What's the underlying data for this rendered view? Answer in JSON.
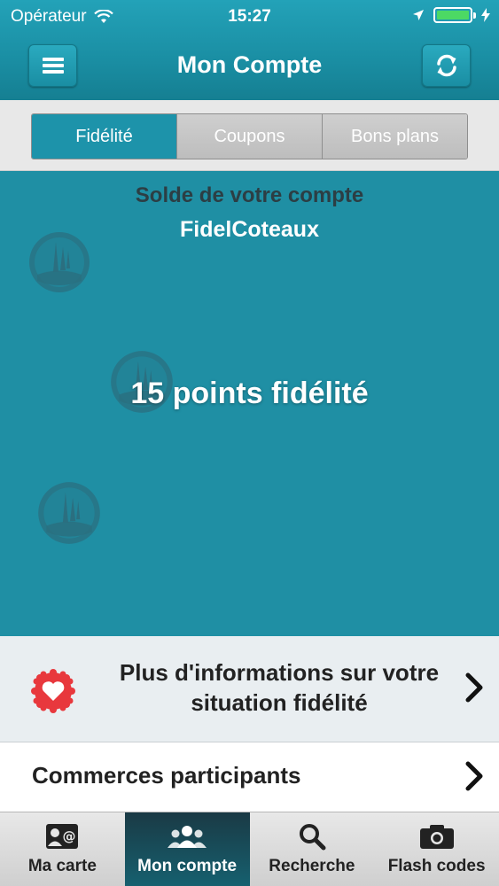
{
  "status": {
    "carrier": "Opérateur",
    "time": "15:27"
  },
  "nav": {
    "title": "Mon Compte",
    "menu_icon": "hamburger-menu-icon",
    "refresh_icon": "refresh-icon"
  },
  "segments": [
    {
      "label": "Fidélité",
      "active": true
    },
    {
      "label": "Coupons",
      "active": false
    },
    {
      "label": "Bons plans",
      "active": false
    }
  ],
  "balance": {
    "title": "Solde de votre compte",
    "account_name": "FidelCoteaux",
    "points": "15 points fidélité"
  },
  "info_row": {
    "label": "Plus d'informations sur votre situation fidélité",
    "icon": "heart-badge-icon"
  },
  "merchants_row": {
    "label": "Commerces participants"
  },
  "tabs": [
    {
      "label": "Ma carte",
      "icon": "contact-card-icon",
      "active": false
    },
    {
      "label": "Mon compte",
      "icon": "people-icon",
      "active": true
    },
    {
      "label": "Recherche",
      "icon": "search-icon",
      "active": false
    },
    {
      "label": "Flash codes",
      "icon": "camera-icon",
      "active": false
    }
  ],
  "colors": {
    "accent": "#1f8fa4",
    "nav_bar": "#1a8ea3",
    "active_tab": "#16606f",
    "heart": "#e8383d",
    "battery": "#4cd964"
  }
}
